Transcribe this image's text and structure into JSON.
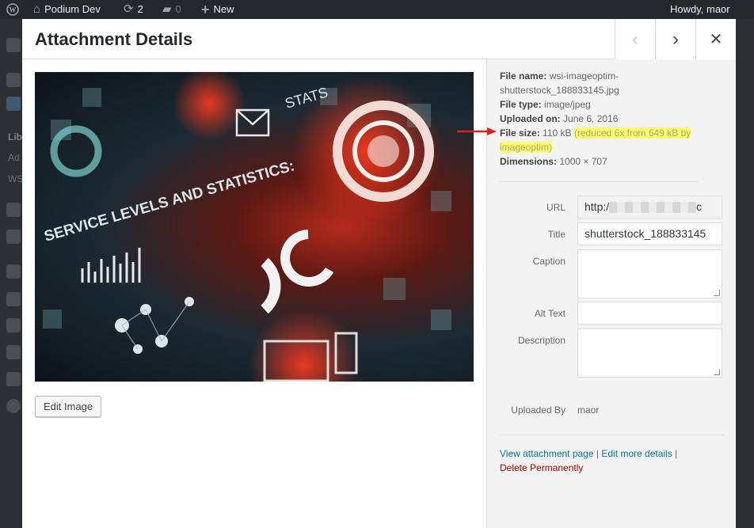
{
  "admin_bar": {
    "wp_logo_icon": "wordpress-logo-icon",
    "site_name": "Podium Dev",
    "updates_count": "2",
    "comments_count": "0",
    "new_label": "New",
    "greeting": "Howdy, maor"
  },
  "sidebar_menu": {
    "items": [
      "Lib",
      "Ad",
      "WS"
    ]
  },
  "modal": {
    "title": "Attachment Details",
    "prev_icon": "chevron-left-icon",
    "next_icon": "chevron-right-icon",
    "close_icon": "close-icon"
  },
  "preview": {
    "image_texts": {
      "headline": "SERVICE LEVELS AND STATISTICS:",
      "stats": "STATS"
    },
    "edit_button": "Edit Image"
  },
  "file_details": {
    "file_name_label": "File name:",
    "file_name": "wsi-imageoptim-shutterstock_188833145.jpg",
    "file_type_label": "File type:",
    "file_type": "image/jpeg",
    "uploaded_on_label": "Uploaded on:",
    "uploaded_on": "June 6, 2016",
    "file_size_label": "File size:",
    "file_size": "110 kB",
    "file_size_note": "(reduced 6x from 649 kB by imageoptim)",
    "dimensions_label": "Dimensions:",
    "dimensions": "1000 × 707"
  },
  "fields": {
    "url_label": "URL",
    "url_value_start": "http:/",
    "url_value_end": "c",
    "title_label": "Title",
    "title_value": "shutterstock_188833145",
    "caption_label": "Caption",
    "caption_value": "",
    "alt_label": "Alt Text",
    "alt_value": "",
    "description_label": "Description",
    "description_value": "",
    "uploaded_by_label": "Uploaded By",
    "uploaded_by_value": "maor"
  },
  "actions": {
    "view_attachment": "View attachment page",
    "separator": "|",
    "edit_more": "Edit more details",
    "delete": "Delete Permanently"
  },
  "colors": {
    "link": "#0073aa",
    "delete": "#aa0000",
    "highlight": "#ffff6e",
    "annotation_arrow": "#e0201a"
  }
}
